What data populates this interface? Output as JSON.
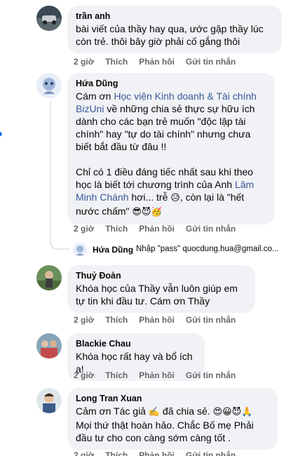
{
  "comments": [
    {
      "author": "trần anh",
      "text": "bài viết của thầy hay qua, ước gặp thầy lúc còn trẻ. thôi bây giờ phải cố gắng thôi",
      "time": "2 giờ",
      "like": "Thích",
      "reply": "Phản hồi",
      "message": "Gửi tin nhắn"
    },
    {
      "author": "Hứa Dũng",
      "p1_a": "Cám ơn ",
      "p1_link": "Học viện Kinh doanh & Tài chính BizUni",
      "p1_b": " về những chia sẻ thực sự hữu ích dành cho các bạn trẻ muốn \"độc lập tài chính\" hay \"tự do tài chính\" nhưng chưa biết bắt đầu từ đâu !!",
      "p2_a": "Chỉ có 1 điều đáng tiếc nhất sau khi theo học là biết tới chương trình của Anh ",
      "p2_link": "Lâm Minh Chánh",
      "p2_b": " hơi... trễ ",
      "p2_emoji1": "😥",
      "p2_c": ", còn lại là \"hết nước chấm\" ",
      "p2_emoji2": "😎😈🥳",
      "time": "2 giờ",
      "like": "Thích",
      "reply": "Phản hồi",
      "message": "Gửi tin nhắn"
    },
    {
      "author": "Thuỷ Đoàn",
      "text": "Khóa học của Thầy vẫn luôn giúp em tự tin khi đầu tư. Cám ơn Thầy",
      "time": "2 giờ",
      "like": "Thích",
      "reply": "Phản hồi",
      "message": "Gửi tin nhắn"
    },
    {
      "author": "Blackie Chau",
      "text": "Khóa học rất hay và bổ ích ạ!",
      "time": "2 giờ",
      "like": "Thích",
      "reply": "Phản hồi",
      "message": "Gửi tin nhắn"
    },
    {
      "author": "Long Tran Xuan",
      "text_a": "Cảm ơn Tác giả ",
      "emoji_a": "✍️",
      "text_b": " đã chia sẻ. ",
      "emoji_b": "😍😀😈🙏",
      "text_c": " Mọi thứ thật hoàn hảo. Chắc Bố mẹ Phải đầu tư cho con càng sớm càng tốt .",
      "time": "2 giờ",
      "like": "Thích",
      "reply": "Phản hồi",
      "message": "Gửi tin nhắn"
    }
  ],
  "reply_preview": {
    "author": "Hứa Dũng",
    "text": "Nhập \"pass\" quocdung.hua@gmail.co..."
  },
  "colors": {
    "bubble": "#f0f2f5",
    "link": "#385898",
    "secondary_text": "#65676b",
    "thread_line": "#e4e6eb"
  }
}
